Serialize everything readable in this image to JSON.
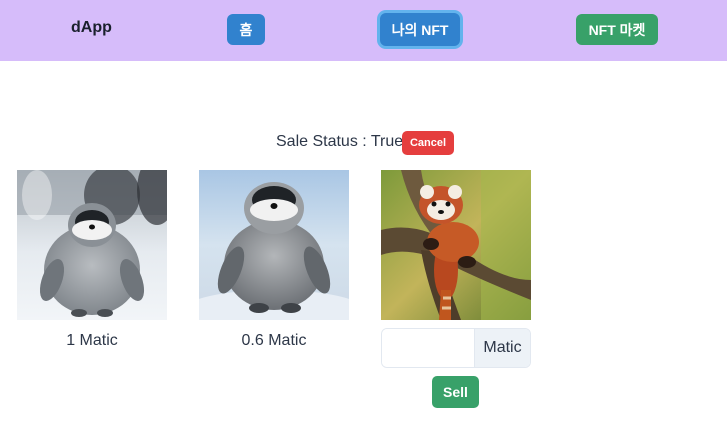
{
  "header": {
    "brand": "dApp",
    "home_label": "홈",
    "my_nft_label": "나의 NFT",
    "market_label": "NFT 마켓"
  },
  "sale": {
    "status_text": "Sale Status : True",
    "cancel_label": "Cancel"
  },
  "nfts": [
    {
      "price": "1 Matic"
    },
    {
      "price": "0.6 Matic"
    },
    {
      "input_value": "",
      "unit": "Matic",
      "sell_label": "Sell"
    }
  ],
  "colors": {
    "topbar": "#d6bcfa",
    "blue_button": "#3182ce",
    "green_button": "#38a169",
    "red_button": "#e53e3e"
  }
}
